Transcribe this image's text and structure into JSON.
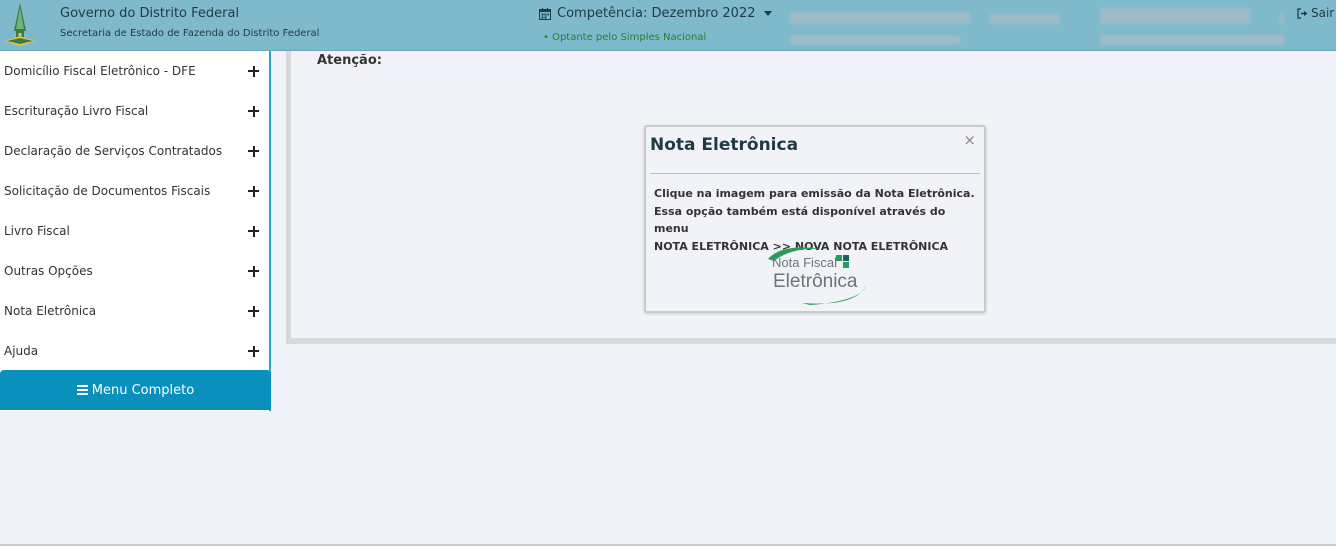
{
  "header": {
    "gov_title": "Governo do Distrito Federal",
    "gov_subtitle": "Secretaria de Estado de Fazenda do Distrito Federal",
    "competencia": "Competência: Dezembro 2022",
    "simples": "• Optante pelo Simples Nacional",
    "sair": "Sair"
  },
  "sidebar": {
    "items": [
      {
        "label": "Domicílio Fiscal Eletrônico - DFE"
      },
      {
        "label": "Escrituração Livro Fiscal"
      },
      {
        "label": "Declaração de Serviços Contratados"
      },
      {
        "label": "Solicitação de Documentos Fiscais"
      },
      {
        "label": "Livro Fiscal"
      },
      {
        "label": "Outras Opções"
      },
      {
        "label": "Nota Eletrônica"
      },
      {
        "label": "Ajuda"
      }
    ],
    "menu_completo": "Menu Completo"
  },
  "main": {
    "atencao": "Atenção:"
  },
  "modal": {
    "title": "Nota Eletrônica",
    "close": "×",
    "body_line1": "Clique na imagem para emissão da Nota Eletrônica.",
    "body_line2": "Essa opção também está disponível através do menu",
    "body_line3": "NOTA ELETRÔNICA >> NOVA NOTA ELETRÔNICA",
    "logo_line1": "Nota Fiscal",
    "logo_line2": "Eletrônica"
  },
  "colors": {
    "header_bg": "#7fb9cc",
    "accent": "#0a90bc",
    "simples_green": "#2e7d32",
    "logo_green": "#2a9d5c"
  }
}
